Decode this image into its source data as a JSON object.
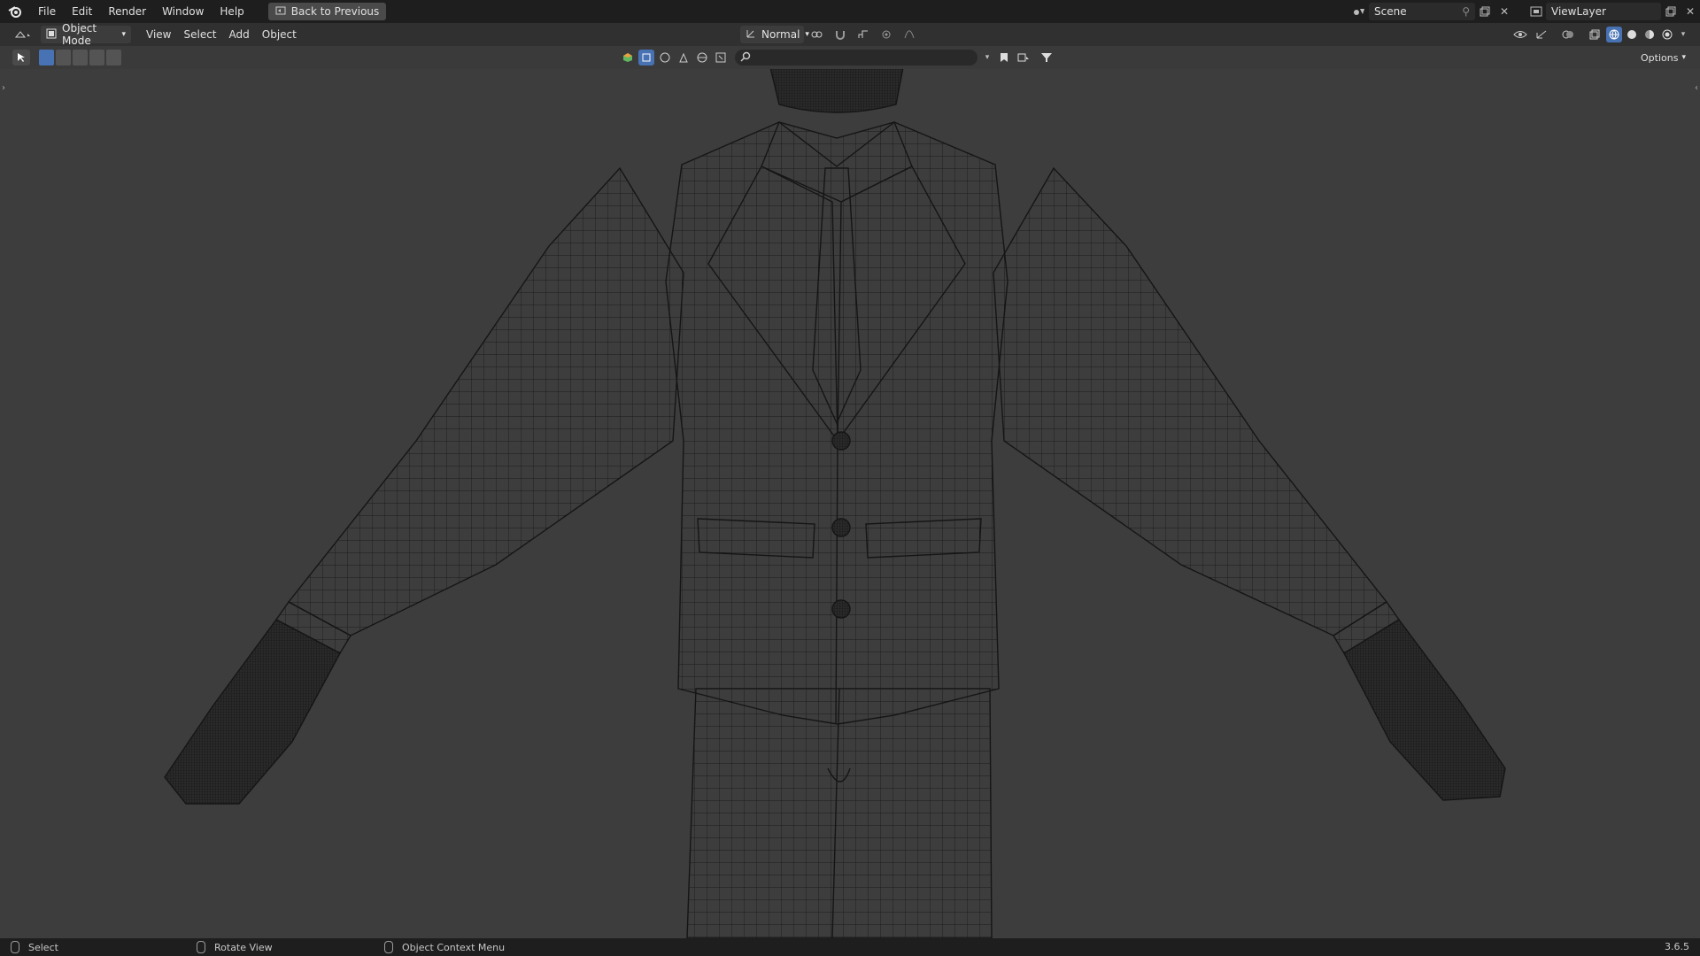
{
  "topbar": {
    "menus": [
      "File",
      "Edit",
      "Render",
      "Window",
      "Help"
    ],
    "back_button": "Back to Previous",
    "scene": "Scene",
    "view_layer": "ViewLayer"
  },
  "viewport_header": {
    "mode": "Object Mode",
    "menus": [
      "View",
      "Select",
      "Add",
      "Object"
    ],
    "orientation": "Normal"
  },
  "toolrow": {
    "options": "Options"
  },
  "statusbar": {
    "left": "Select",
    "middle": "Rotate View",
    "right": "Object Context Menu",
    "version": "3.6.5"
  },
  "colors": {
    "accent": "#4772b3",
    "background": "#3d3d3d",
    "wire": "#1a1a1a"
  }
}
